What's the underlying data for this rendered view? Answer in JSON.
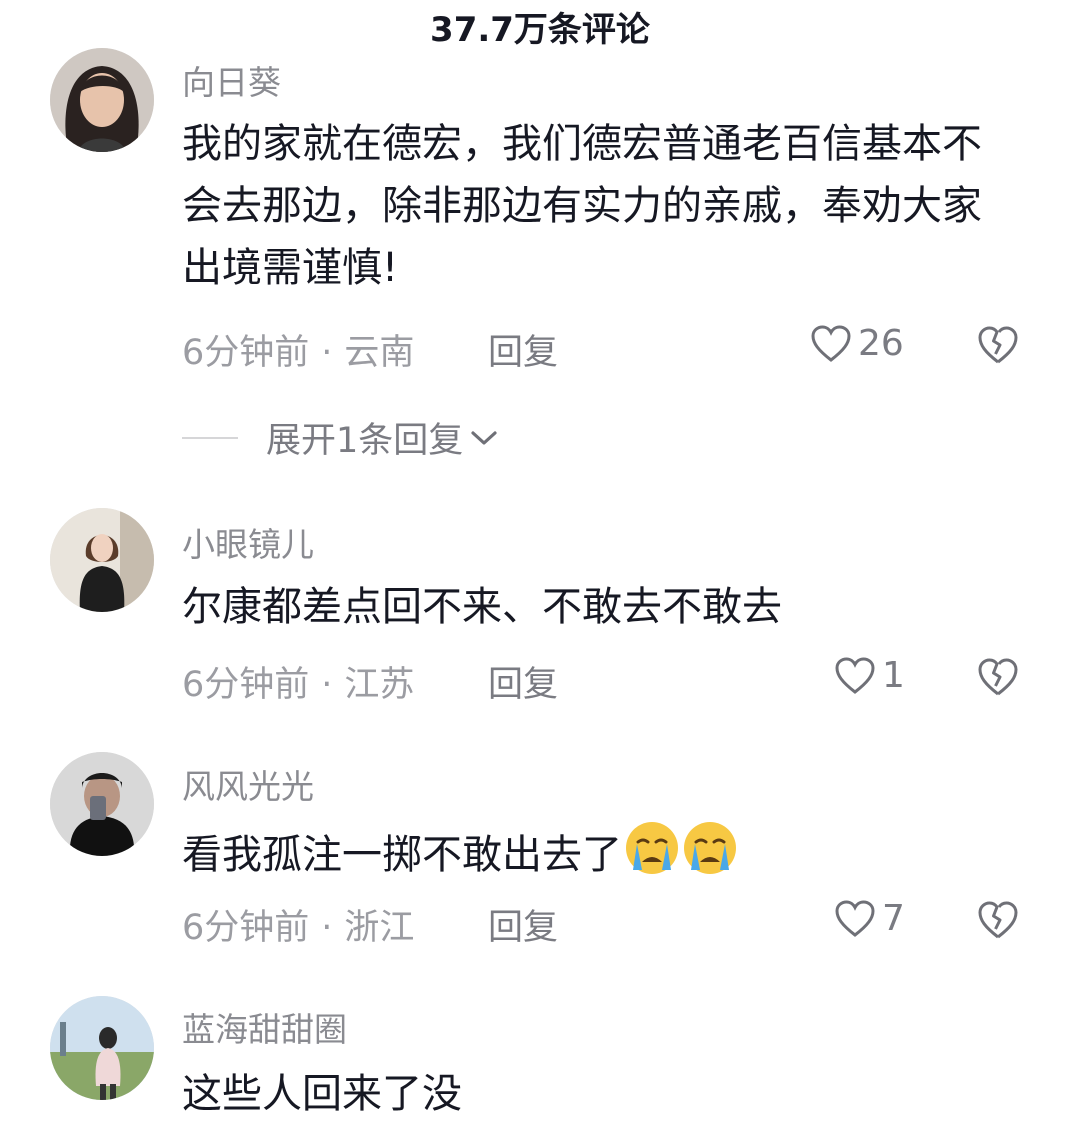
{
  "header": {
    "title": "37.7万条评论"
  },
  "actions": {
    "reply_label": "回复",
    "separator": "·"
  },
  "comments": [
    {
      "username": "向日葵",
      "text": "我的家就在德宏，我们德宏普通老百信基本不会去那边，除非那边有实力的亲戚，奉劝大家出境需谨慎!",
      "time": "6分钟前",
      "location": "云南",
      "likes": "26",
      "expand_replies": "展开1条回复"
    },
    {
      "username": "小眼镜儿",
      "text": "尔康都差点回不来、不敢去不敢去",
      "time": "6分钟前",
      "location": "江苏",
      "likes": "1"
    },
    {
      "username": "风风光光",
      "text": "看我孤注一掷不敢出去了",
      "emojis": [
        "crying-face",
        "crying-face"
      ],
      "time": "6分钟前",
      "location": "浙江",
      "likes": "7"
    },
    {
      "username": "蓝海甜甜圈",
      "text": "这些人回来了没"
    }
  ],
  "icons": {
    "like": "heart-outline-icon",
    "dislike": "broken-heart-outline-icon",
    "expand": "chevron-down-icon"
  },
  "colors": {
    "text": "#161823",
    "muted": "#8a8b91",
    "emoji_face": "#f7c843",
    "emoji_tear": "#4aa8e8"
  }
}
